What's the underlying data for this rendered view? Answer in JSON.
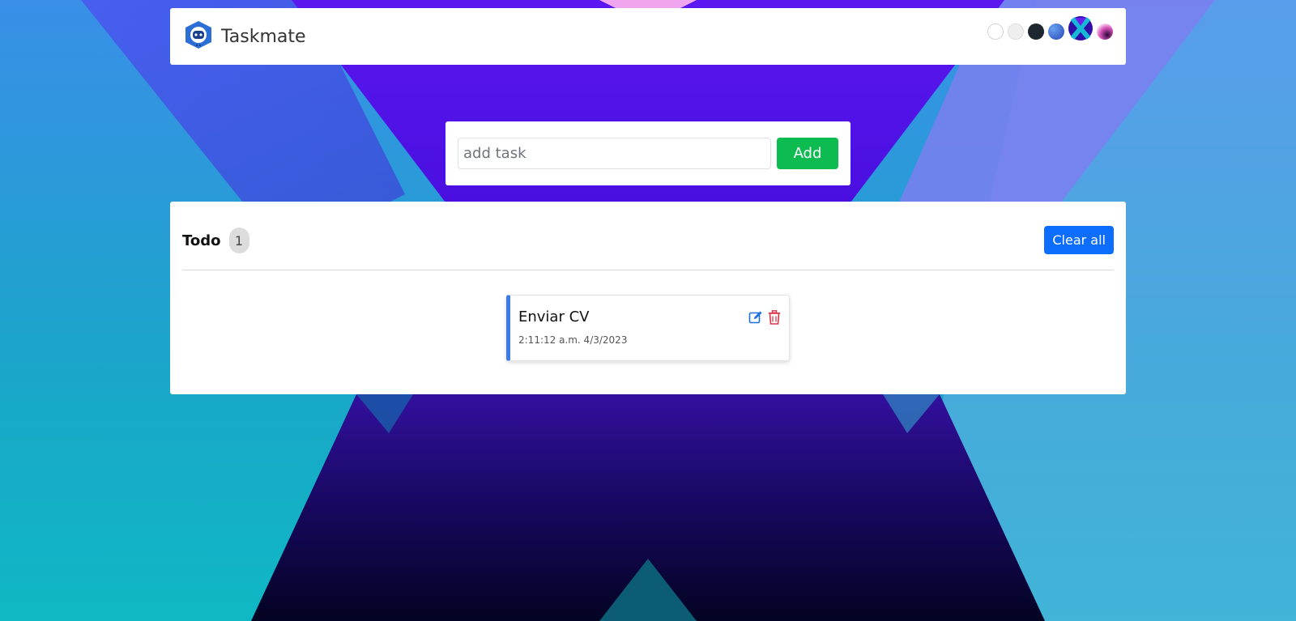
{
  "app": {
    "brand": "Taskmate"
  },
  "theme_swatches": [
    {
      "name": "light",
      "color": "#ffffff"
    },
    {
      "name": "light-gray",
      "color": "#eeeeee"
    },
    {
      "name": "dark",
      "color": "#1e2630"
    },
    {
      "name": "blue",
      "color": "#3f6fd6"
    },
    {
      "name": "gradient-active",
      "color": "#3b12c7"
    },
    {
      "name": "pink",
      "color": "#d64fb7"
    }
  ],
  "add_task": {
    "placeholder": "add task",
    "value": "",
    "button_label": "Add"
  },
  "todo": {
    "title": "Todo",
    "count": "1",
    "clear_label": "Clear all",
    "tasks": [
      {
        "name": "Enviar CV",
        "time": "2:11:12 a.m. 4/3/2023"
      }
    ]
  },
  "colors": {
    "add_button": "#0cbc51",
    "clear_button": "#0d6efd",
    "task_accent": "#3f7be6",
    "edit_icon": "#1d6fe0",
    "delete_icon": "#dc3545"
  }
}
